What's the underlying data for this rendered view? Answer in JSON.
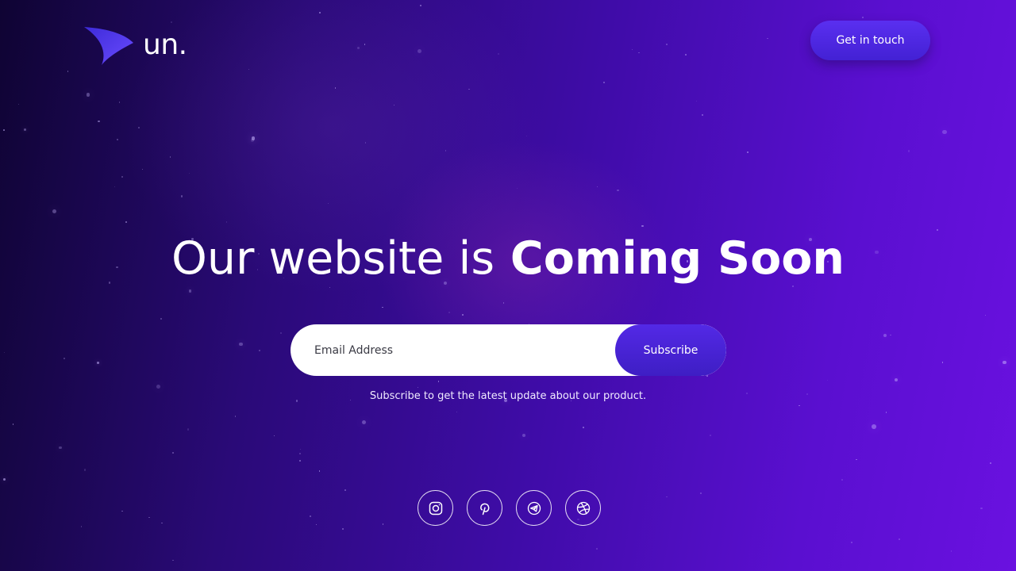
{
  "brand": {
    "name": "un.",
    "accent": "#5b3df5"
  },
  "header": {
    "contact_label": "Get in touch"
  },
  "hero": {
    "title_regular": "Our website is",
    "title_bold": "Coming Soon"
  },
  "subscribe": {
    "email_placeholder": "Email Address",
    "button_label": "Subscribe",
    "note": "Subscribe to get the latest update about our product."
  },
  "social": [
    {
      "icon": "instagram-icon"
    },
    {
      "icon": "pinterest-icon"
    },
    {
      "icon": "telegram-icon"
    },
    {
      "icon": "dribbble-icon"
    }
  ],
  "colors": {
    "background_dark": "#0f0433",
    "background_light": "#6a11e0",
    "button": "#4a25dc"
  }
}
